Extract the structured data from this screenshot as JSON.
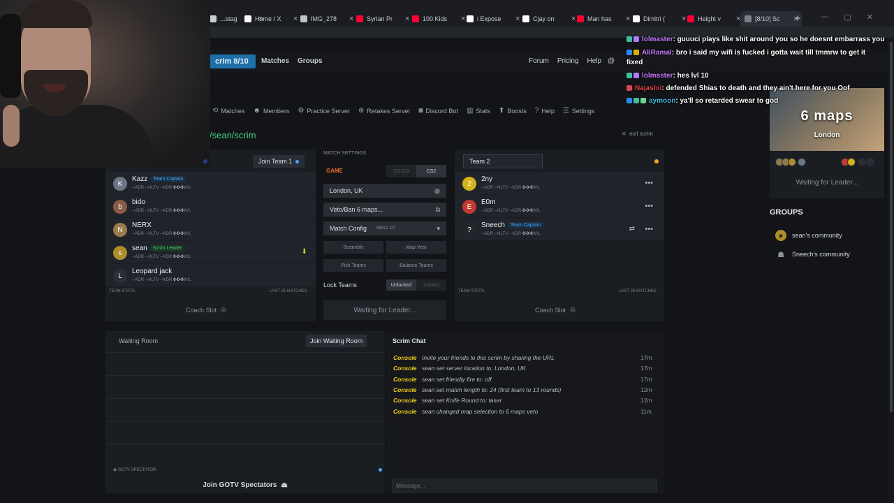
{
  "browser": {
    "tabs": [
      {
        "title": "...stag",
        "color": "#c9ccd2",
        "icon": "tab-icon"
      },
      {
        "title": "Home / X",
        "color": "#ffffff",
        "icon": "x-icon"
      },
      {
        "title": "IMG_278",
        "color": "#bfc3c9",
        "icon": "globe-icon"
      },
      {
        "title": "Syrian Pr",
        "color": "#ff0033",
        "icon": "youtube-icon"
      },
      {
        "title": "100 Kids",
        "color": "#ff0033",
        "icon": "youtube-icon"
      },
      {
        "title": "i Expose",
        "color": "#ffffff",
        "icon": "x-icon"
      },
      {
        "title": "Cjay on",
        "color": "#ffffff",
        "icon": "x-icon"
      },
      {
        "title": "Man has",
        "color": "#ff0033",
        "icon": "youtube-icon"
      },
      {
        "title": "Dimitri (",
        "color": "#ffffff",
        "icon": "tiktok-icon"
      },
      {
        "title": "Height v",
        "color": "#ff0033",
        "icon": "youtube-icon"
      },
      {
        "title": "[8/10] Sc",
        "color": "#7a7f86",
        "icon": "page-icon",
        "active": true
      }
    ],
    "new_tab": "+",
    "minimize": "—",
    "maximize": "▢",
    "close": "✕"
  },
  "header": {
    "scrim_badge": "crim 8/10",
    "nav": [
      "Matches",
      "Groups"
    ],
    "right_nav": [
      "Forum",
      "Pricing",
      "Help"
    ],
    "user": "@"
  },
  "sub_nav": [
    {
      "label": "Matches",
      "icon": "history-icon",
      "glyph": "⟲"
    },
    {
      "label": "Members",
      "icon": "members-icon",
      "glyph": "☻"
    },
    {
      "label": "Practice Server",
      "icon": "server-icon",
      "glyph": "⚙"
    },
    {
      "label": "Retakes Server",
      "icon": "crosshair-icon",
      "glyph": "⊕"
    },
    {
      "label": "Discord Bot",
      "icon": "discord-icon",
      "glyph": "◙"
    },
    {
      "label": "Stats",
      "icon": "stats-icon",
      "glyph": "▥"
    },
    {
      "label": "Boosts",
      "icon": "boost-icon",
      "glyph": "⬆"
    },
    {
      "label": "Help",
      "icon": "help-icon",
      "glyph": "?"
    },
    {
      "label": "Settings",
      "icon": "settings-icon",
      "glyph": "☰"
    }
  ],
  "scrim_path": "/sean/scrim",
  "exit_scrim": "exit scrim",
  "exit_icon": "✕",
  "team1": {
    "join_label": "Join Team 1",
    "players": [
      {
        "name": "Kazz",
        "tag": "Team Captain",
        "tag_type": "captain",
        "avatar": "K",
        "avatar_color": "#6b7788"
      },
      {
        "name": "bido",
        "tag": "",
        "tag_type": "",
        "avatar": "b",
        "avatar_color": "#8a5a48"
      },
      {
        "name": "NERX",
        "tag": "",
        "tag_type": "",
        "avatar": "N",
        "avatar_color": "#9c7a4c"
      },
      {
        "name": "sean",
        "tag": "Scrim Leader",
        "tag_type": "leader",
        "avatar": "s",
        "avatar_color": "#b08d2b"
      },
      {
        "name": "Leopard jack",
        "tag": "",
        "tag_type": "",
        "avatar": "L",
        "avatar_color": "#2b2f35"
      }
    ],
    "team_stats": "TEAM STATS:",
    "last_matches": "LAST 25 MATCHES",
    "coach_slot": "Coach Slot"
  },
  "team2": {
    "name_value": "Team 2",
    "players": [
      {
        "name": "2ny",
        "tag": "",
        "tag_type": "",
        "avatar": "2",
        "avatar_color": "#d4b21c"
      },
      {
        "name": "E0m",
        "tag": "",
        "tag_type": "",
        "avatar": "E",
        "avatar_color": "#c23a32"
      },
      {
        "name": "Sneech",
        "tag": "Team Captain",
        "tag_type": "captain",
        "avatar": "?",
        "avatar_color": "#22262b"
      }
    ],
    "team_stats": "TEAM STATS:",
    "coach_slot": "Coach Slot"
  },
  "player_stats": {
    "adr": "--ADR",
    "hltv": "--HLTV",
    "kdr": "--KDR",
    "record": "0-0-0",
    "wl": "W/L"
  },
  "match_settings": {
    "title": "MATCH SETTINGS",
    "game_label": "GAME",
    "game_options": [
      "CS:GO",
      "CS2"
    ],
    "location": "London, UK",
    "veto": "Veto/Ban 6 maps...",
    "match_config": "Match Config",
    "match_config_value": "MR12, OT",
    "buttons": [
      "Scramble",
      "Map Veto",
      "Pick Teams",
      "Balance Teams"
    ],
    "lock_label": "Lock Teams",
    "lock_options": [
      "Unlocked",
      "Locked"
    ],
    "waiting": "Waiting for Leader..."
  },
  "waiting_room": {
    "title": "Waiting Room",
    "join": "Join Waiting Room",
    "gotv_label": "GOTV SPECTATOR",
    "gotv_join": "Join GOTV Spectators"
  },
  "chat": {
    "title": "Scrim Chat",
    "messages": [
      {
        "source": "Console",
        "text": "Invite your friends to this scrim by sharing the URL",
        "time": "17m"
      },
      {
        "source": "Console",
        "text": "sean set server location to: London, UK",
        "time": "17m"
      },
      {
        "source": "Console",
        "text": "sean set friendly fire to: off",
        "time": "17m"
      },
      {
        "source": "Console",
        "text": "sean set match length to: 24 (first team to 13 rounds)",
        "time": "12m"
      },
      {
        "source": "Console",
        "text": "sean set Knife Round to: taser",
        "time": "12m"
      },
      {
        "source": "Console",
        "text": "sean changed map selection to 6 maps veto",
        "time": "11m"
      }
    ],
    "placeholder": "Message..."
  },
  "sidebar": {
    "promo_maps": "6 maps",
    "promo_city": "London",
    "promo_wait": "Waiting for Leader...",
    "groups_title": "GROUPS",
    "groups": [
      {
        "name": "sean's community",
        "icon": "group-avatar-icon"
      },
      {
        "name": "Sneech's community",
        "icon": "people-icon"
      }
    ]
  },
  "twitch_chat": [
    {
      "user": "lolmaster",
      "color": "#c77dff",
      "text": ": guuuci plays like shit around you so he doesnt embarrass you",
      "badges": [
        "#3fbf9f",
        "#b07bff"
      ]
    },
    {
      "user": "AliRamal",
      "color": "#c77dff",
      "text": ": bro i said my wifi is fucked i gotta wait till tmmrw to get it fixed",
      "badges": [
        "#2d88ff",
        "#e0b000"
      ]
    },
    {
      "user": "lolmaster",
      "color": "#c77dff",
      "text": ": hes lvl 10",
      "badges": [
        "#3fbf9f",
        "#b07bff"
      ]
    },
    {
      "user": "Najashii",
      "color": "#e0444a",
      "text": ": defended Shias to death and they ain't here for you Oof",
      "badges": [
        "#e0444a"
      ]
    },
    {
      "user": "aymoon",
      "color": "#3fb8e0",
      "text": ": ya'll so retarded swear to god",
      "badges": [
        "#2d88ff",
        "#3fbf9f",
        "#6cd48a"
      ]
    }
  ]
}
